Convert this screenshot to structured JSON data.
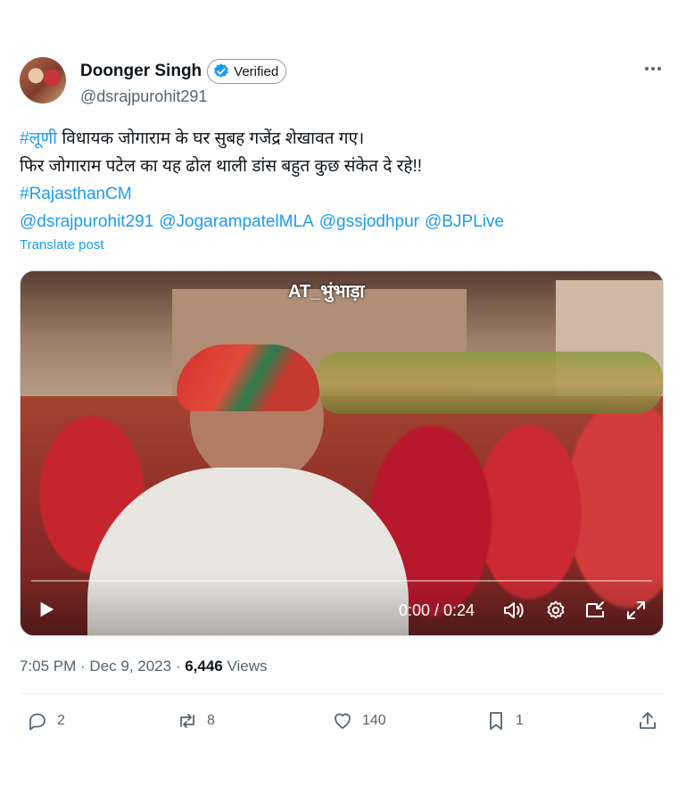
{
  "author": {
    "display_name": "Doonger Singh",
    "verified_label": "Verified",
    "handle": "@dsrajpurohit291"
  },
  "post": {
    "line1_hashtag": "#लूणी",
    "line1_text": " विधायक जोगाराम के घर सुबह गजेंद्र शेखावत गए।",
    "line2_text": "फिर जोगाराम पटेल का यह ढोल थाली डांस बहुत कुछ संकेत दे रहे!!",
    "hashtag2": "#RajasthanCM",
    "mentions": [
      "@dsrajpurohit291",
      "@JogarampatelMLA",
      "@gssjodhpur",
      "@BJPLive"
    ],
    "translate_label": "Translate post"
  },
  "video": {
    "watermark": "AT_भुंभाड़ा",
    "time_display": "0:00 / 0:24",
    "progress_fraction": 0
  },
  "meta": {
    "time": "7:05 PM",
    "separator": " · ",
    "date": "Dec 9, 2023",
    "views_count": "6,446",
    "views_label": " Views"
  },
  "actions": {
    "replies": "2",
    "reposts": "8",
    "likes": "140",
    "bookmarks": "1"
  },
  "colors": {
    "accent": "#1d9bf0",
    "text_primary": "#0f1419",
    "text_secondary": "#536471"
  },
  "icons": [
    "verified-icon",
    "more-icon",
    "play-icon",
    "volume-icon",
    "settings-icon",
    "pip-icon",
    "fullscreen-icon",
    "reply-icon",
    "repost-icon",
    "like-icon",
    "bookmark-icon",
    "share-icon"
  ]
}
